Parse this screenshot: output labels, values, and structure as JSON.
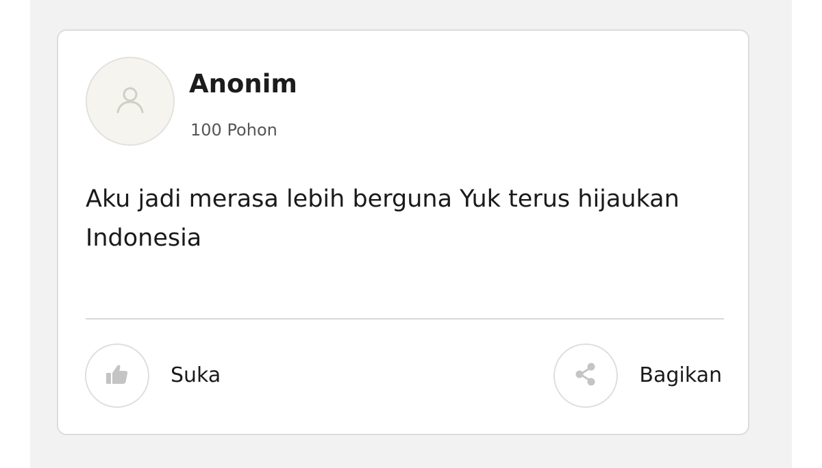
{
  "post": {
    "author_name": "Anonim",
    "author_meta": "100 Pohon",
    "avatar_icon": "user-icon",
    "comment": "Aku jadi merasa lebih berguna Yuk terus hijaukan Indonesia"
  },
  "actions": {
    "like": {
      "label": "Suka",
      "icon": "thumbs-up-icon"
    },
    "share": {
      "label": "Bagikan",
      "icon": "share-icon"
    }
  },
  "colors": {
    "icon_gray": "#c4c4c4",
    "avatar_bg": "#f5f4ef",
    "border": "#dcdcdc",
    "backdrop": "#f2f2f2"
  }
}
